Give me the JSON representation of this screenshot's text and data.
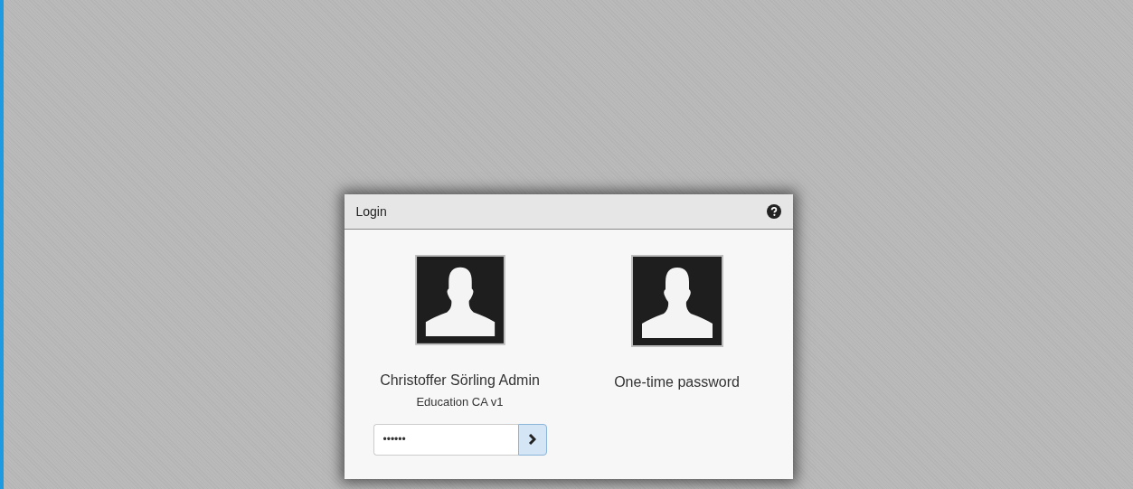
{
  "dialog": {
    "title": "Login",
    "accounts": [
      {
        "kind": "password",
        "name": "Christoffer Sörling Admin",
        "subtitle": "Education CA v1",
        "field": {
          "value": "••••••"
        }
      },
      {
        "kind": "otp",
        "name": "One-time password"
      }
    ]
  }
}
